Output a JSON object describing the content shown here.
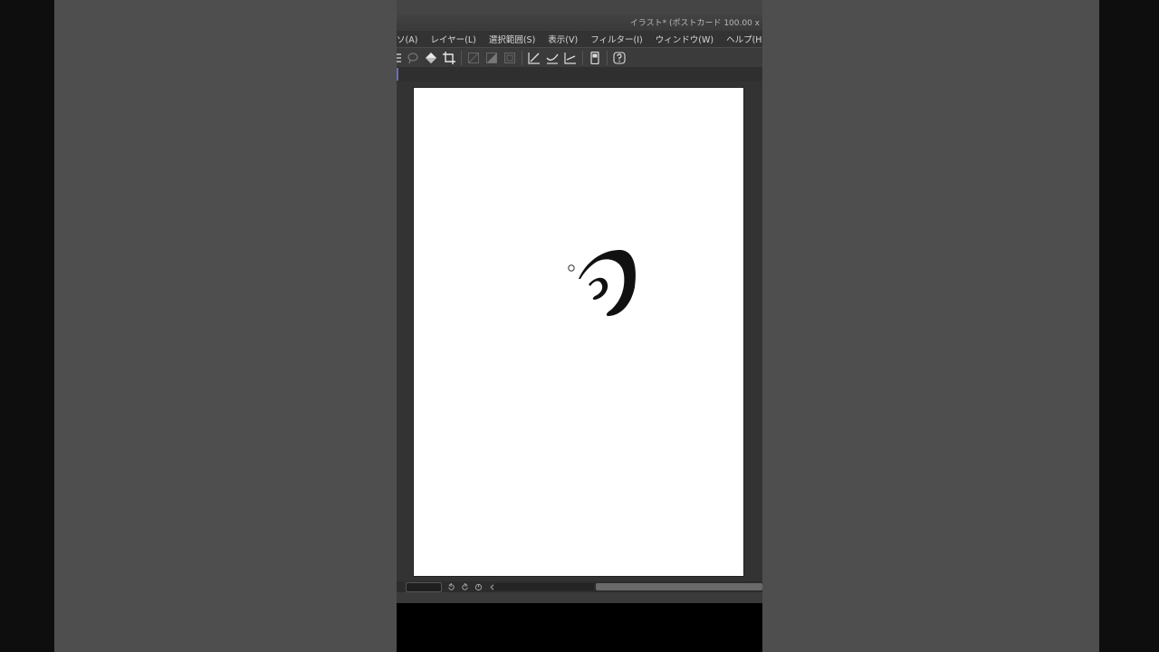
{
  "window": {
    "doc_title": "イラスト* (ポストカード 100.00 x"
  },
  "menu": [
    {
      "label": "ソ(A)"
    },
    {
      "label": "レイヤー(L)"
    },
    {
      "label": "選択範囲(S)"
    },
    {
      "label": "表示(V)"
    },
    {
      "label": "フィルター(I)"
    },
    {
      "label": "ウィンドウ(W)"
    },
    {
      "label": "ヘルプ(H)"
    }
  ],
  "toolbar_icons": [
    "transform-icon",
    "lasso-icon",
    "fill-bucket-icon",
    "crop-icon",
    "mask-off-icon",
    "gradient-mask-icon",
    "frame-icon",
    "ruler-line-icon",
    "ruler-curve-icon",
    "ruler-perspective-icon",
    "device-icon",
    "help-icon"
  ],
  "canvas": {
    "paper_color": "#ffffff",
    "stroke_color": "#111111",
    "brush_cursor": "circle-cursor"
  },
  "colors": {
    "background": "#4e4e4e",
    "app_bg": "#383838",
    "menu_text": "#d8d8d8"
  }
}
